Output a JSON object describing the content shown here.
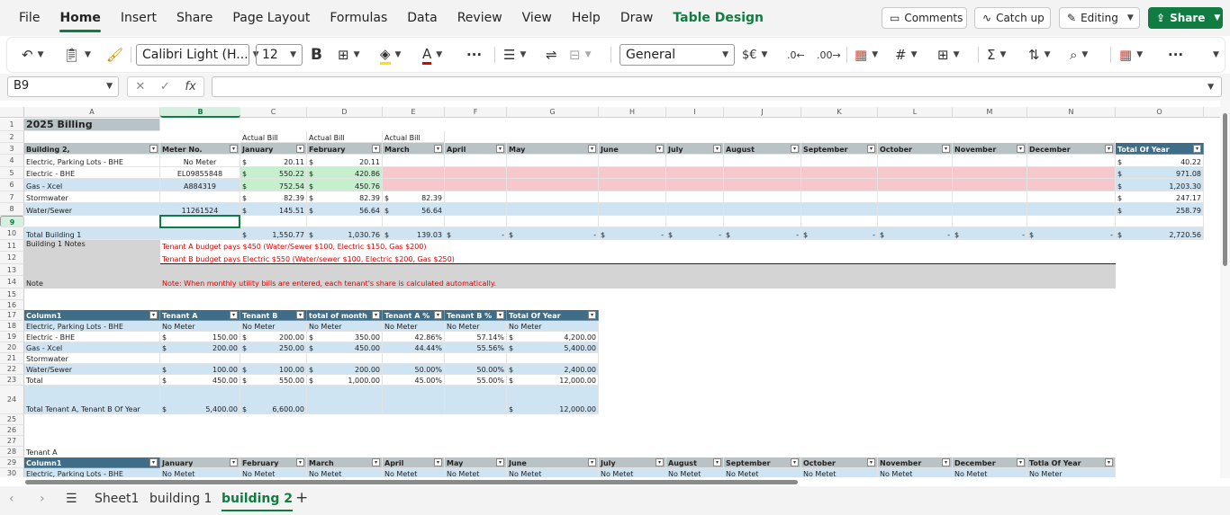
{
  "menu": {
    "tabs": [
      "File",
      "Home",
      "Insert",
      "Share",
      "Page Layout",
      "Formulas",
      "Data",
      "Review",
      "View",
      "Help",
      "Draw",
      "Table Design"
    ],
    "comments": "Comments",
    "catch_up": "Catch up",
    "editing": "Editing",
    "share": "Share"
  },
  "ribbon": {
    "font": "Calibri Light (H...",
    "size": "12",
    "bold": "B",
    "format": "General",
    "currency": "$€"
  },
  "formula": {
    "namebox": "B9",
    "fx": "fx"
  },
  "colors": {
    "accent": "#107c41",
    "header": "#3f6c87",
    "light_blue": "#cfe4f2",
    "pink": "#f7c7ce",
    "green": "#c6efce",
    "red": "#e00000"
  },
  "sheet": {
    "columns": [
      "A",
      "B",
      "C",
      "D",
      "E",
      "F",
      "G",
      "H",
      "I",
      "J",
      "K",
      "L",
      "M",
      "N",
      "O"
    ],
    "rows": [
      "1",
      "2",
      "3",
      "4",
      "5",
      "6",
      "7",
      "8",
      "9",
      "10",
      "11",
      "12",
      "13",
      "14",
      "15",
      "16",
      "17",
      "18",
      "19",
      "20",
      "21",
      "22",
      "23",
      "24",
      "25",
      "26",
      "27",
      "28",
      "29",
      "30"
    ],
    "selected_cell": "B9",
    "cells": {
      "t1": "2025 Billing",
      "ab1": "Actual Bill",
      "ab2": "Actual Bill",
      "ab3": "Actual Bill",
      "h3": [
        "Building 2,",
        "Meter No.",
        "January",
        "February",
        "March",
        "April",
        "May",
        "June",
        "July",
        "August",
        "September",
        "October",
        "November",
        "December",
        "Total Of Year"
      ],
      "r4": {
        "name": "Electric, Parking Lots - BHE",
        "meter": "No Meter",
        "jan_s": "$",
        "jan": "20.11",
        "feb_s": "$",
        "feb": "20.11",
        "tot_s": "$",
        "tot": "40.22"
      },
      "r5": {
        "name": "Electric - BHE",
        "meter": "EL09855848",
        "jan_s": "$",
        "jan": "550.22",
        "feb_s": "$",
        "feb": "420.86",
        "tot_s": "$",
        "tot": "971.08"
      },
      "r6": {
        "name": "Gas - Xcel",
        "meter": "A884319",
        "jan_s": "$",
        "jan": "752.54",
        "feb_s": "$",
        "feb": "450.76",
        "tot_s": "$",
        "tot": "1,203.30"
      },
      "r7": {
        "name": "Stormwater",
        "jan_s": "$",
        "jan": "82.39",
        "feb_s": "$",
        "feb": "82.39",
        "mar_s": "$",
        "mar": "82.39",
        "tot_s": "$",
        "tot": "247.17"
      },
      "r8": {
        "name": "Water/Sewer",
        "meter": "11261524",
        "jan_s": "$",
        "jan": "145.51",
        "feb_s": "$",
        "feb": "56.64",
        "mar_s": "$",
        "mar": "56.64",
        "tot_s": "$",
        "tot": "258.79"
      },
      "r10": {
        "name": "Total Building 1",
        "dollar": "$",
        "dash": "-",
        "jan": "1,550.77",
        "feb": "1,030.76",
        "mar": "139.03",
        "tot": "2,720.56"
      },
      "r11a": "Building 1 Notes",
      "r11b": "Tenant A budget pays $450 (Water/Sewer $100, Electric $150, Gas $200)",
      "r12": "Tenant B budget pays Electric $550 (Water/sewer $100, Electric $200, Gas $250)",
      "r14a": "Note",
      "r14b": "Note: When monthly utility bills are entered, each tenant's share is calculated automatically.",
      "h17": [
        "Column1",
        "Tenant A",
        "Tenant B",
        "total of month",
        "Tenant A %",
        "Tenant B %",
        "Total Of Year"
      ],
      "r18": [
        "Electric, Parking Lots - BHE",
        "No Meter",
        "No Meter",
        "No Meter",
        "No Meter",
        "No Meter",
        "No Meter"
      ],
      "r19": {
        "name": "Electric - BHE",
        "d": "$",
        "a": "150.00",
        "b": "200.00",
        "t": "350.00",
        "ap": "42.86%",
        "bp": "57.14%",
        "y": "4,200.00"
      },
      "r20": {
        "name": "Gas - Xcel",
        "a": "200.00",
        "b": "250.00",
        "t": "450.00",
        "ap": "44.44%",
        "bp": "55.56%",
        "y": "5,400.00"
      },
      "r21": {
        "name": "Stormwater"
      },
      "r22": {
        "name": "Water/Sewer",
        "a": "100.00",
        "b": "100.00",
        "t": "200.00",
        "ap": "50.00%",
        "bp": "50.00%",
        "y": "2,400.00"
      },
      "r23": {
        "name": "Total",
        "a": "450.00",
        "b": "550.00",
        "t": "1,000.00",
        "ap": "45.00%",
        "bp": "55.00%",
        "y": "12,000.00"
      },
      "r24": {
        "name": "Total Tenant A, Tenant B Of Year",
        "a": "5,400.00",
        "b": "6,600.00",
        "y": "12,000.00"
      },
      "r28": "Tenant A",
      "h29": [
        "Column1",
        "January",
        "February",
        "March",
        "April",
        "May",
        "June",
        "July",
        "August",
        "September",
        "October",
        "November",
        "December",
        "Totla Of Year"
      ],
      "r30": [
        "Electric, Parking Lots - BHE",
        "No Metet",
        "No Metet",
        "No Metet",
        "No Metet",
        "No Metet",
        "No Metet",
        "No Metet",
        "No Metet",
        "No Metet",
        "No Metet",
        "No Metet",
        "No Metet",
        "No Meter"
      ]
    }
  },
  "sheets": {
    "items": [
      "Sheet1",
      "building 1",
      "building 2"
    ],
    "active": "building 2",
    "add": "+"
  }
}
